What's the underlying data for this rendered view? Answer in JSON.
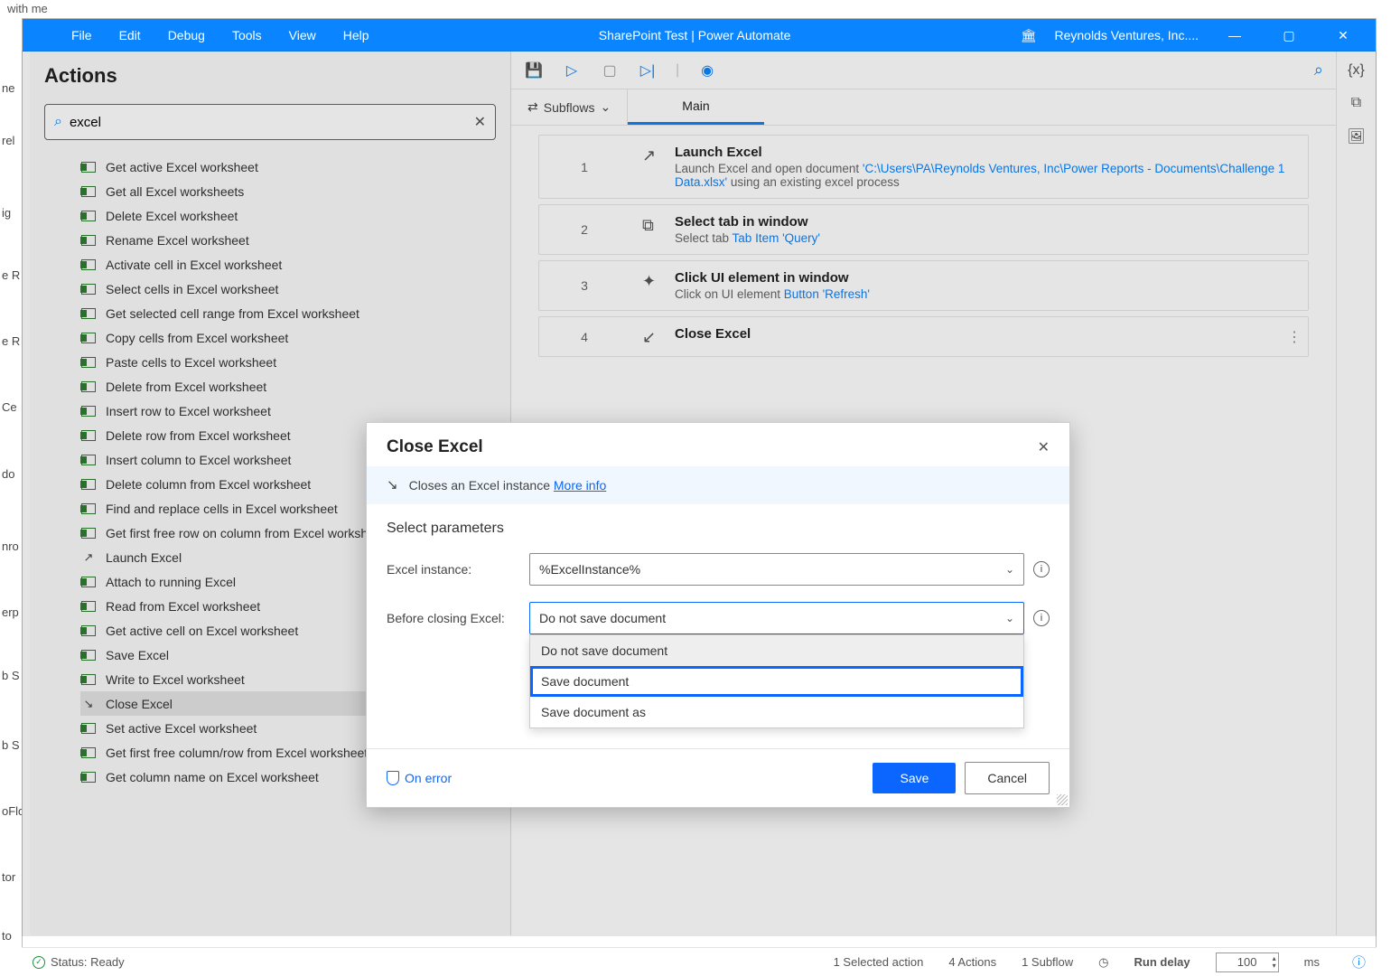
{
  "outer": {
    "top": "with me"
  },
  "leftEdge": [
    "ne",
    "rel",
    "ig",
    "e R",
    "e R",
    "Ce",
    "do",
    "nro",
    "erp",
    "b S",
    "b S",
    "oFlo",
    "tor",
    "to"
  ],
  "menu": [
    "File",
    "Edit",
    "Debug",
    "Tools",
    "View",
    "Help"
  ],
  "title": "SharePoint Test | Power Automate",
  "org": "Reynolds Ventures, Inc....",
  "actionsHeader": "Actions",
  "searchValue": "excel",
  "actions": [
    {
      "icon": "xl",
      "label": "Get active Excel worksheet"
    },
    {
      "icon": "xl",
      "label": "Get all Excel worksheets"
    },
    {
      "icon": "xl",
      "label": "Delete Excel worksheet"
    },
    {
      "icon": "xl",
      "label": "Rename Excel worksheet"
    },
    {
      "icon": "xl",
      "label": "Activate cell in Excel worksheet"
    },
    {
      "icon": "xl",
      "label": "Select cells in Excel worksheet"
    },
    {
      "icon": "xl",
      "label": "Get selected cell range from Excel worksheet"
    },
    {
      "icon": "xl",
      "label": "Copy cells from Excel worksheet"
    },
    {
      "icon": "xl",
      "label": "Paste cells to Excel worksheet"
    },
    {
      "icon": "xl",
      "label": "Delete from Excel worksheet"
    },
    {
      "icon": "xl",
      "label": "Insert row to Excel worksheet"
    },
    {
      "icon": "xl",
      "label": "Delete row from Excel worksheet"
    },
    {
      "icon": "xl",
      "label": "Insert column to Excel worksheet"
    },
    {
      "icon": "xl",
      "label": "Delete column from Excel worksheet"
    },
    {
      "icon": "xl",
      "label": "Find and replace cells in Excel worksheet"
    },
    {
      "icon": "xl",
      "label": "Get first free row on column from Excel worksheet"
    },
    {
      "icon": "up",
      "label": "Launch Excel"
    },
    {
      "icon": "xl",
      "label": "Attach to running Excel"
    },
    {
      "icon": "xl",
      "label": "Read from Excel worksheet"
    },
    {
      "icon": "xl",
      "label": "Get active cell on Excel worksheet"
    },
    {
      "icon": "xl",
      "label": "Save Excel"
    },
    {
      "icon": "xl",
      "label": "Write to Excel worksheet"
    },
    {
      "icon": "dn",
      "label": "Close Excel",
      "active": true
    },
    {
      "icon": "xl",
      "label": "Set active Excel worksheet"
    },
    {
      "icon": "xl",
      "label": "Get first free column/row from Excel worksheet"
    },
    {
      "icon": "xl",
      "label": "Get column name on Excel worksheet"
    }
  ],
  "subflowLabel": "Subflows",
  "mainTab": "Main",
  "steps": [
    {
      "num": "1",
      "icon": "↗",
      "title": "Launch Excel",
      "desc": "Launch Excel and open document ",
      "link": "'C:\\Users\\PA\\Reynolds Ventures, Inc\\Power Reports - Documents\\Challenge 1 Data.xlsx'",
      "desc2": " using an existing excel process"
    },
    {
      "num": "2",
      "icon": "⧉",
      "title": "Select tab in window",
      "desc": "Select tab ",
      "link": "Tab Item 'Query'",
      "desc2": ""
    },
    {
      "num": "3",
      "icon": "✦",
      "title": "Click UI element in window",
      "desc": "Click on UI element ",
      "link": "Button 'Refresh'",
      "desc2": ""
    },
    {
      "num": "4",
      "icon": "↙",
      "title": "Close Excel",
      "desc": "",
      "link": "",
      "desc2": "",
      "more": true
    }
  ],
  "modal": {
    "title": "Close Excel",
    "infoText": "Closes an Excel instance ",
    "infoLink": "More info",
    "section": "Select parameters",
    "param1Label": "Excel instance:",
    "param1Value": "%ExcelInstance%",
    "param2Label": "Before closing Excel:",
    "param2Value": "Do not save document",
    "ddOptions": [
      "Do not save document",
      "Save document",
      "Save document as"
    ],
    "ddHighlightIndex": 1,
    "onError": "On error",
    "save": "Save",
    "cancel": "Cancel"
  },
  "status": {
    "ready": "Status: Ready",
    "selected": "1 Selected action",
    "actions": "4 Actions",
    "subflows": "1 Subflow",
    "delayLabel": "Run delay",
    "delayValue": "100",
    "delayUnit": "ms"
  }
}
